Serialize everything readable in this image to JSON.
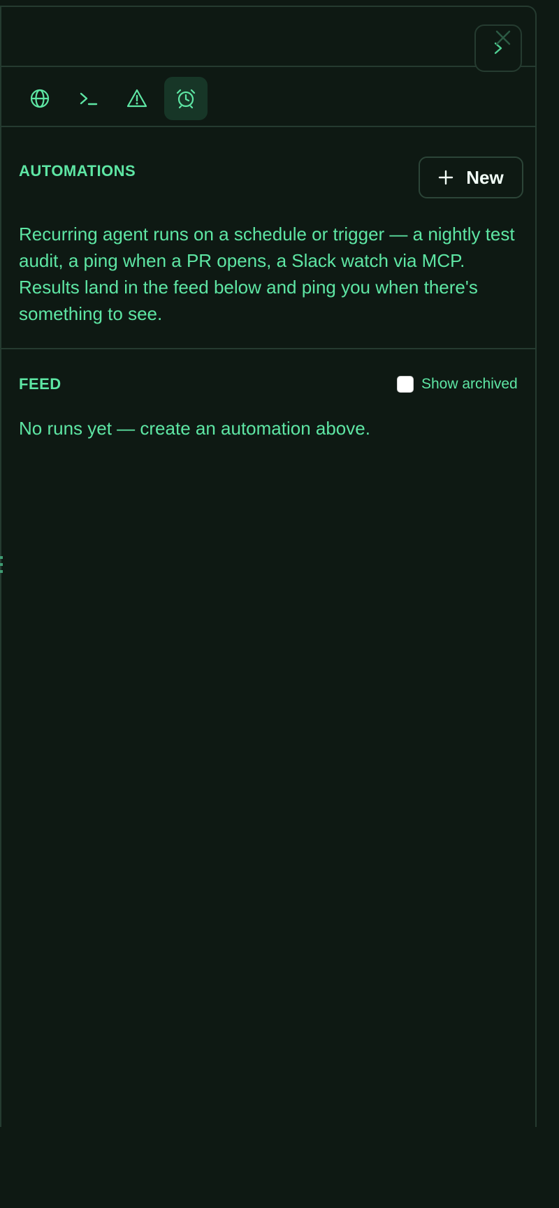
{
  "header": {
    "collapse_icon": "chevron-right-icon",
    "close_icon": "close-icon"
  },
  "toolbar": {
    "tools": [
      {
        "icon": "globe-icon",
        "active": false
      },
      {
        "icon": "terminal-icon",
        "active": false
      },
      {
        "icon": "warning-icon",
        "active": false
      },
      {
        "icon": "alarm-clock-icon",
        "active": true
      }
    ]
  },
  "automations": {
    "title": "AUTOMATIONS",
    "new_button_label": "New",
    "new_button_icon": "plus-icon",
    "description": "Recurring agent runs on a schedule or trigger — a nightly test audit, a ping when a PR opens, a Slack watch via MCP. Results land in the feed below and ping you when there's something to see."
  },
  "feed": {
    "title": "FEED",
    "show_archived_label": "Show archived",
    "show_archived_checked": false,
    "empty_message": "No runs yet — create an automation above."
  },
  "colors": {
    "background": "#0e1913",
    "accent": "#5ee6a4",
    "border": "#253b30",
    "active_tab_bg": "#173627"
  }
}
